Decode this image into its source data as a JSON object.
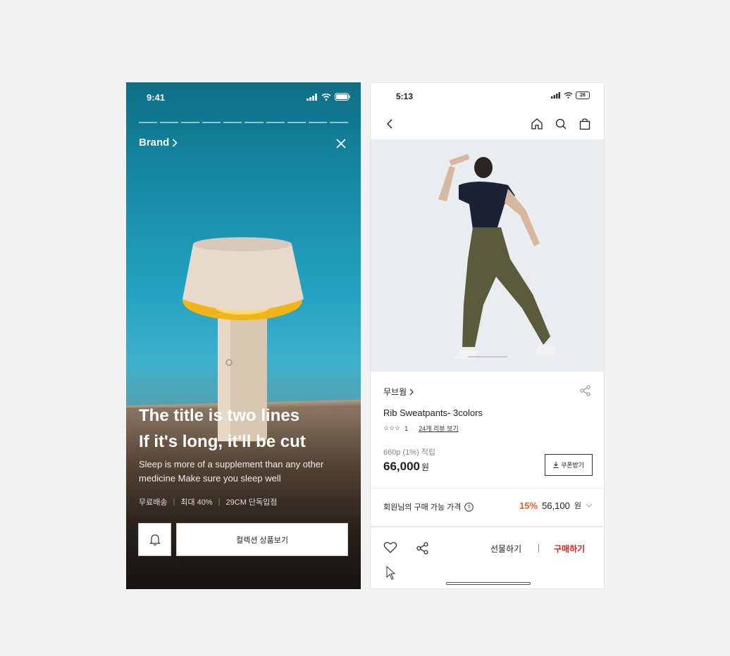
{
  "left_screen": {
    "status": {
      "time": "9:41"
    },
    "brand_label": "Brand",
    "title_line1": "The title is two lines",
    "title_line2": "If it's long, it'll be cut",
    "description": "Sleep is more of a supplement than any other medicine Make sure you sleep well",
    "tags": [
      "무료배송",
      "최대 40%",
      "29CM 단독입점"
    ],
    "cta_label": "컬렉션 상품보기",
    "icons": {
      "close": "close-icon",
      "bell": "bell-icon",
      "chevron": "chevron-right-icon"
    }
  },
  "right_screen": {
    "status": {
      "time": "5:13",
      "battery": "26"
    },
    "brand_name": "무브웜",
    "product_name": "Rib Sweatpants- 3colors",
    "rating": "1",
    "review_link": "24개 리뷰 보기",
    "points": "660p (1%) 적립",
    "price": "66,000",
    "price_unit": "원",
    "coupon_label": "쿠폰받기",
    "member_price_label": "회원님의 구매 가능 가격",
    "member_discount": "15%",
    "member_price": "56,100",
    "member_price_unit": "원",
    "gift_label": "선물하기",
    "buy_label": "구매하기",
    "colors": {
      "discount": "#e8622d",
      "buy": "#e02020"
    }
  }
}
